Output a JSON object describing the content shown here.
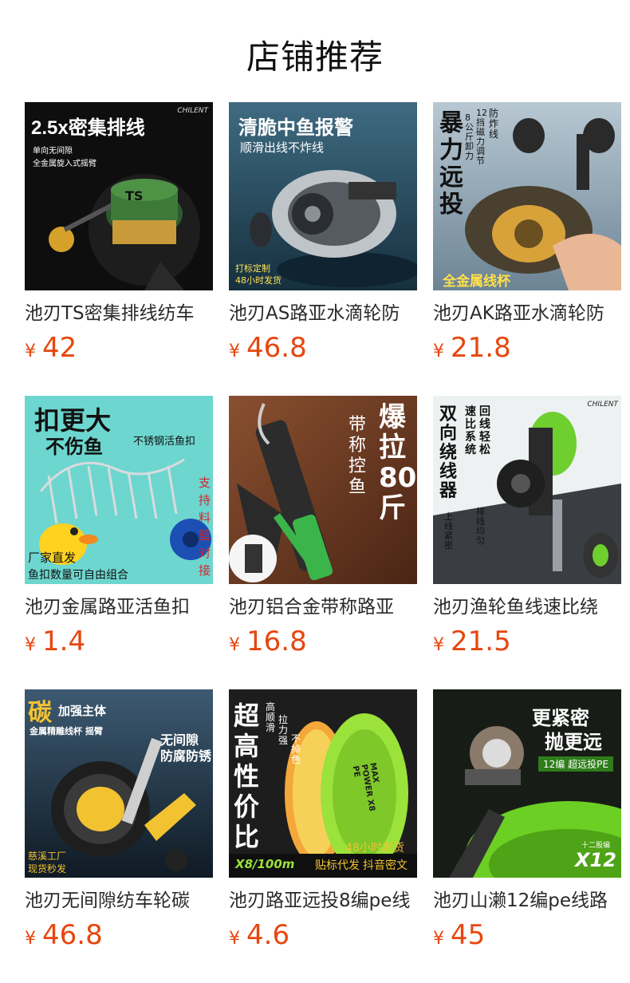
{
  "section": {
    "title": "店铺推荐"
  },
  "currency": "¥",
  "products": [
    {
      "name": "池刃TS密集排线纺车",
      "price": "42",
      "thumb": {
        "bg": "#0e0e0e",
        "accent": "#c99a3a",
        "texts": [
          "2.5x密集排线",
          "单向无间隙",
          "全金属旋入式摇臂",
          "CHILENT",
          "TS"
        ]
      }
    },
    {
      "name": "池刃AS路亚水滴轮防",
      "price": "46.8",
      "thumb": {
        "bg": "#27495c",
        "accent": "#3fd36a",
        "texts": [
          "清脆中鱼报警",
          "顺滑出线不炸线",
          "打标定制",
          "48小时发货"
        ]
      }
    },
    {
      "name": "池刃AK路亚水滴轮防",
      "price": "21.8",
      "thumb": {
        "bg": "#8fa6b4",
        "accent": "#ffe04a",
        "texts": [
          "暴力远投",
          "防炸线",
          "12挡磁力调节",
          "8公斤卸力",
          "全金属线杯"
        ]
      }
    },
    {
      "name": "池刃金属路亚活鱼扣",
      "price": "1.4",
      "thumb": {
        "bg": "#6dd6cf",
        "accent": "#d4262a",
        "texts": [
          "扣更大",
          "不伤鱼",
          "不锈钢活鱼扣",
          "支持料篮对接",
          "厂家直发",
          "鱼扣数量可自由组合"
        ]
      }
    },
    {
      "name": "池刃铝合金带称路亚",
      "price": "16.8",
      "thumb": {
        "bg": "#6b3a22",
        "accent": "#3bb54a",
        "texts": [
          "爆拉80斤",
          "带称控鱼"
        ]
      }
    },
    {
      "name": "池刃渔轮鱼线速比绕",
      "price": "21.5",
      "thumb": {
        "bg": "#eef1f2",
        "accent": "#6fcf2f",
        "texts": [
          "双向绕线器",
          "速比系统",
          "回线轻松",
          "上线紧密",
          "排线均匀",
          "CHILENT"
        ]
      }
    },
    {
      "name": "池刃无间隙纺车轮碳",
      "price": "46.8",
      "thumb": {
        "bg": "#223344",
        "accent": "#f2c230",
        "texts": [
          "碳",
          "加强主体",
          "金属精雕线杯 摇臂",
          "无间隙",
          "防腐防锈",
          "慈溪工厂",
          "现货秒发"
        ]
      }
    },
    {
      "name": "池刃路亚远投8编pe线",
      "price": "4.6",
      "thumb": {
        "bg": "#1d1d1d",
        "accent": "#9be23a",
        "texts": [
          "超高性价比",
          "高顺滑",
          "拉力强",
          "不掉色",
          "X8/100m",
          "贴标代发",
          "抖音密文",
          "48小时发货",
          "MAX POWER X8 PE"
        ]
      }
    },
    {
      "name": "池刃山濑12编pe线路",
      "price": "45",
      "thumb": {
        "bg": "#171c17",
        "accent": "#6ccf24",
        "texts": [
          "更紧密",
          "抛更远",
          "12编 超远投PE",
          "十二股编",
          "X12"
        ]
      }
    }
  ]
}
